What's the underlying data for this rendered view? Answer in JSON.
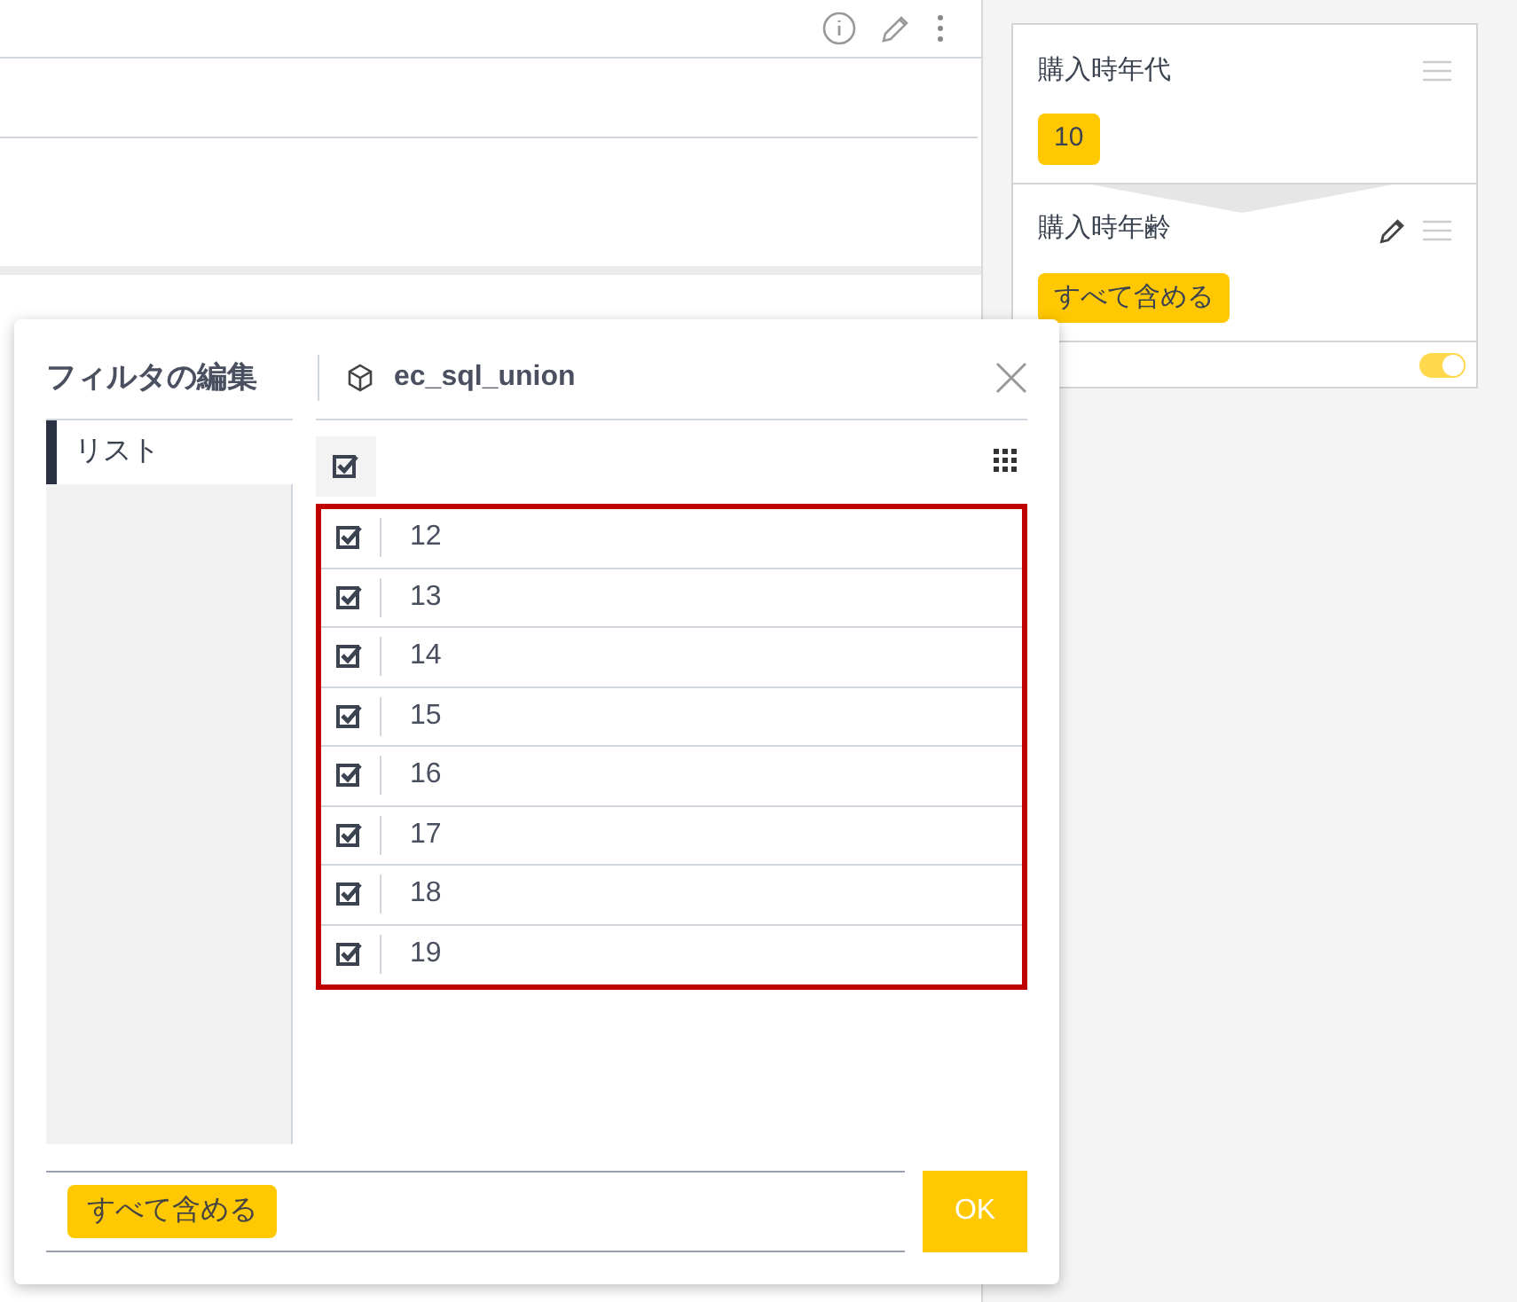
{
  "filter_panel": {
    "filters": [
      {
        "title": "購入時年代",
        "chip": "10",
        "editable": false
      },
      {
        "title": "購入時年齢",
        "chip": "すべて含める",
        "editable": true
      }
    ],
    "toggle": {
      "on": true
    }
  },
  "dialog": {
    "title": "フィルタの編集",
    "dataset": "ec_sql_union",
    "tabs": [
      {
        "label": "リスト",
        "selected": true
      }
    ],
    "select_all": {
      "checked": true
    },
    "items": [
      {
        "label": "12",
        "checked": true
      },
      {
        "label": "13",
        "checked": true
      },
      {
        "label": "14",
        "checked": true
      },
      {
        "label": "15",
        "checked": true
      },
      {
        "label": "16",
        "checked": true
      },
      {
        "label": "17",
        "checked": true
      },
      {
        "label": "18",
        "checked": true
      },
      {
        "label": "19",
        "checked": true
      }
    ],
    "selection_chip": "すべて含める",
    "ok_button": "OK"
  }
}
